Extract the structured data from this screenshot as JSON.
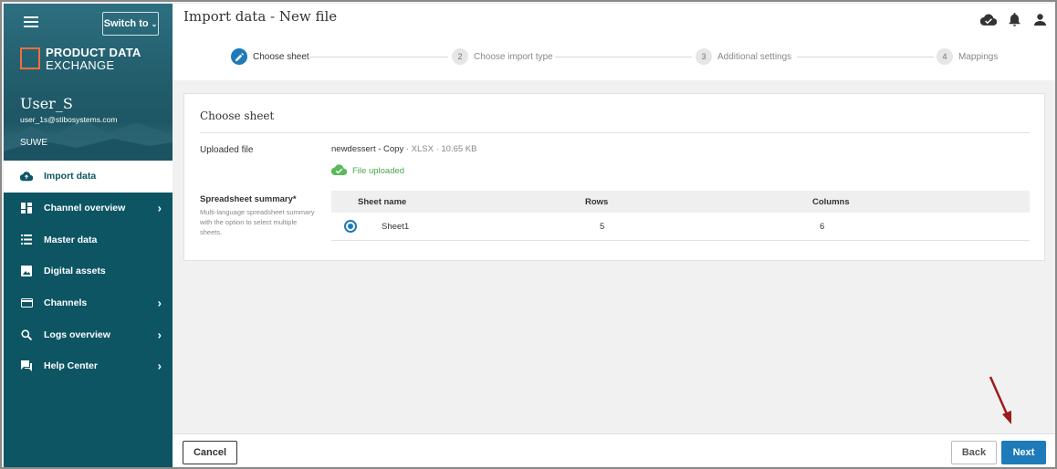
{
  "sidebar": {
    "switch_label": "Switch to",
    "logo_line1": "PRODUCT DATA",
    "logo_line2": "EXCHANGE",
    "user_name": "User_S",
    "user_email": "user_1s@stibosystems.com",
    "org": "SUWE",
    "items": [
      {
        "label": "Import data",
        "icon": "cloud-upload-icon"
      },
      {
        "label": "Channel overview",
        "icon": "dashboard-icon"
      },
      {
        "label": "Master data",
        "icon": "list-icon"
      },
      {
        "label": "Digital assets",
        "icon": "image-icon"
      },
      {
        "label": "Channels",
        "icon": "card-icon"
      },
      {
        "label": "Logs overview",
        "icon": "search-icon"
      },
      {
        "label": "Help Center",
        "icon": "chat-icon"
      }
    ]
  },
  "header": {
    "title": "Import data - New file"
  },
  "stepper": {
    "steps": [
      {
        "num": "",
        "label": "Choose sheet"
      },
      {
        "num": "2",
        "label": "Choose import type"
      },
      {
        "num": "3",
        "label": "Additional settings"
      },
      {
        "num": "4",
        "label": "Mappings"
      }
    ]
  },
  "card": {
    "title": "Choose sheet",
    "uploaded_label": "Uploaded file",
    "file_name": "newdessert - Copy",
    "file_meta": " · XLSX · 10.65 KB",
    "uploaded_status": "File uploaded",
    "summary_label": "Spreadsheet summary*",
    "summary_help": "Multi-language spreadsheet summary with the option to select multiple sheets.",
    "table": {
      "headers": {
        "sheet": "Sheet name",
        "rows": "Rows",
        "columns": "Columns"
      },
      "rows": [
        {
          "sheet": "Sheet1",
          "rows": "5",
          "columns": "6"
        }
      ]
    }
  },
  "footer": {
    "cancel": "Cancel",
    "back": "Back",
    "next": "Next"
  },
  "colors": {
    "sidebar": "#0d5563",
    "primary": "#1e7ab8",
    "success": "#4aa64a",
    "annotation_arrow": "#9b1c1c"
  }
}
